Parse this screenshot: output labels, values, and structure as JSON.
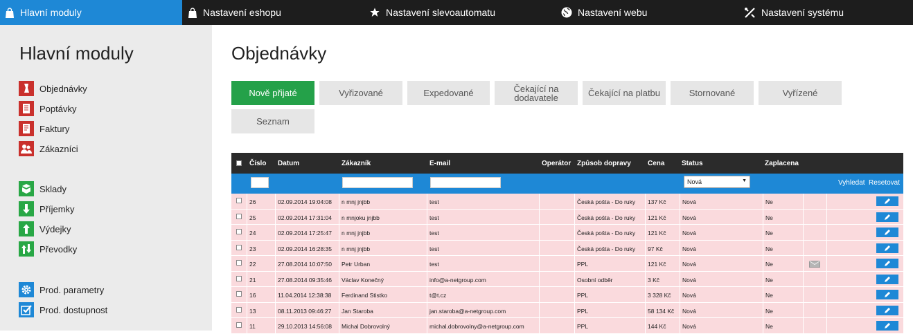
{
  "topnav": {
    "tabs": [
      {
        "label": "Hlavní moduly",
        "icon": "shopping-bag-icon"
      },
      {
        "label": "Nastavení eshopu",
        "icon": "shopping-bag-icon"
      },
      {
        "label": "Nastavení slevoautomatu",
        "icon": "star-icon"
      },
      {
        "label": "Nastavení webu",
        "icon": "globe-icon"
      },
      {
        "label": "Nastavení systému",
        "icon": "tools-icon"
      }
    ]
  },
  "sidebar": {
    "title": "Hlavní moduly",
    "items": [
      {
        "label": "Objednávky",
        "icon": "order-icon",
        "color": "#c9302c"
      },
      {
        "label": "Poptávky",
        "icon": "inquiry-icon",
        "color": "#c9302c"
      },
      {
        "label": "Faktury",
        "icon": "invoice-icon",
        "color": "#c9302c"
      },
      {
        "label": "Zákazníci",
        "icon": "users-icon",
        "color": "#c9302c"
      },
      {
        "label": "Sklady",
        "icon": "warehouse-icon",
        "color": "#28a745"
      },
      {
        "label": "Příjemky",
        "icon": "arrow-down-icon",
        "color": "#28a745"
      },
      {
        "label": "Výdejky",
        "icon": "arrow-up-icon",
        "color": "#28a745"
      },
      {
        "label": "Převodky",
        "icon": "transfer-icon",
        "color": "#28a745"
      },
      {
        "label": "Prod. parametry",
        "icon": "gear-icon",
        "color": "#1e88d6"
      },
      {
        "label": "Prod. dostupnost",
        "icon": "check-icon",
        "color": "#1e88d6"
      }
    ]
  },
  "main": {
    "title": "Objednávky",
    "filters": [
      "Nově přijaté",
      "Vyřizované",
      "Expedované",
      "Čekající na dodavatele",
      "Čekající na platbu",
      "Stornované",
      "Vyřízené",
      "Seznam"
    ]
  },
  "table": {
    "headers": [
      "Číslo",
      "Datum",
      "Zákazník",
      "E-mail",
      "Operátor",
      "Způsob dopravy",
      "Cena",
      "Status",
      "Zaplacena"
    ],
    "status_filter": "Nová",
    "search_label": "Vyhledat",
    "reset_label": "Resetovat",
    "rows": [
      {
        "id": "26",
        "date": "02.09.2014 19:04:08",
        "customer": "n mnj jnjbb",
        "email": "test",
        "operator": "",
        "shipping": "Česká pošta - Do ruky",
        "price": "137 Kč",
        "status": "Nová",
        "paid": "Ne",
        "mail": false
      },
      {
        "id": "25",
        "date": "02.09.2014 17:31:04",
        "customer": "n mnjoku jnjbb",
        "email": "test",
        "operator": "",
        "shipping": "Česká pošta - Do ruky",
        "price": "121 Kč",
        "status": "Nová",
        "paid": "Ne",
        "mail": false
      },
      {
        "id": "24",
        "date": "02.09.2014 17:25:47",
        "customer": "n mnj jnjbb",
        "email": "test",
        "operator": "",
        "shipping": "Česká pošta - Do ruky",
        "price": "121 Kč",
        "status": "Nová",
        "paid": "Ne",
        "mail": false
      },
      {
        "id": "23",
        "date": "02.09.2014 16:28:35",
        "customer": "n mnj jnjbb",
        "email": "test",
        "operator": "",
        "shipping": "Česká pošta - Do ruky",
        "price": "97 Kč",
        "status": "Nová",
        "paid": "Ne",
        "mail": false
      },
      {
        "id": "22",
        "date": "27.08.2014 10:07:50",
        "customer": "Petr Urban",
        "email": "test",
        "operator": "",
        "shipping": "PPL",
        "price": "121 Kč",
        "status": "Nová",
        "paid": "Ne",
        "mail": true
      },
      {
        "id": "21",
        "date": "27.08.2014 09:35:46",
        "customer": "Václav Konečný",
        "email": "info@a-netgroup.com",
        "operator": "",
        "shipping": "Osobní odběr",
        "price": "3 Kč",
        "status": "Nová",
        "paid": "Ne",
        "mail": false
      },
      {
        "id": "16",
        "date": "11.04.2014 12:38:38",
        "customer": "Ferdinand Stistko",
        "email": "t@t.cz",
        "operator": "",
        "shipping": "PPL",
        "price": "3 328 Kč",
        "status": "Nová",
        "paid": "Ne",
        "mail": false
      },
      {
        "id": "13",
        "date": "08.11.2013 09:46:27",
        "customer": "Jan Staroba",
        "email": "jan.staroba@a-netgroup.com",
        "operator": "",
        "shipping": "PPL",
        "price": "58 134 Kč",
        "status": "Nová",
        "paid": "Ne",
        "mail": false
      },
      {
        "id": "11",
        "date": "29.10.2013 14:56:08",
        "customer": "Michal Dobrovolný",
        "email": "michal.dobrovolny@a-netgroup.com",
        "operator": "",
        "shipping": "PPL",
        "price": "144 Kč",
        "status": "Nová",
        "paid": "Ne",
        "mail": false
      }
    ]
  }
}
